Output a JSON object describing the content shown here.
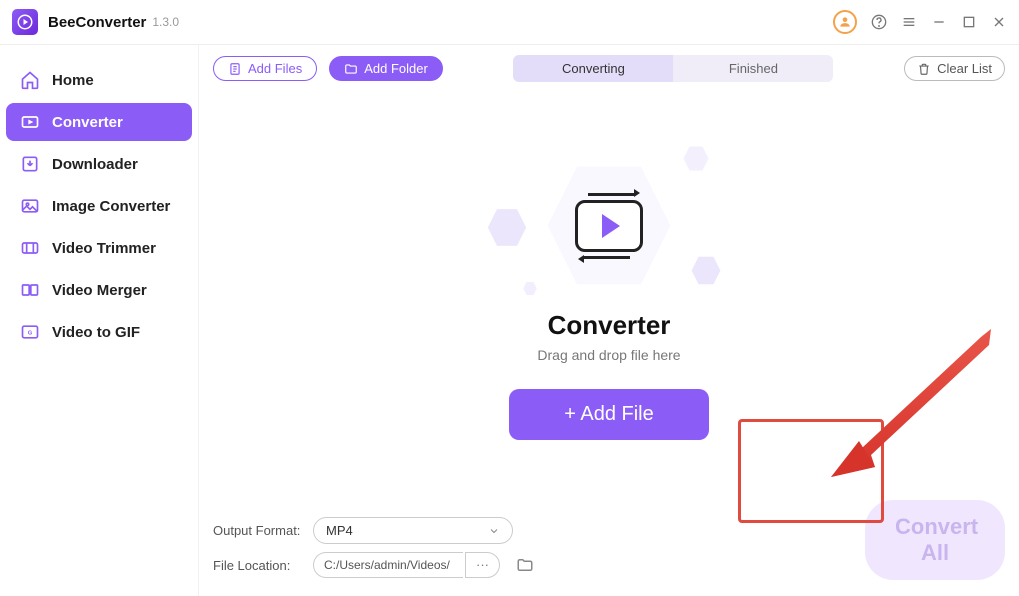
{
  "app": {
    "name": "BeeConverter",
    "version": "1.3.0"
  },
  "sidebar": {
    "items": [
      {
        "label": "Home"
      },
      {
        "label": "Converter"
      },
      {
        "label": "Downloader"
      },
      {
        "label": "Image Converter"
      },
      {
        "label": "Video Trimmer"
      },
      {
        "label": "Video Merger"
      },
      {
        "label": "Video to GIF"
      }
    ]
  },
  "toolbar": {
    "add_files": "Add Files",
    "add_folder": "Add Folder",
    "tab_converting": "Converting",
    "tab_finished": "Finished",
    "clear_list": "Clear List"
  },
  "center": {
    "title": "Converter",
    "subtitle": "Drag and drop file here",
    "add_file": "+ Add File"
  },
  "bottom": {
    "output_format_label": "Output Format:",
    "output_format_value": "MP4",
    "file_location_label": "File Location:",
    "file_location_value": "C:/Users/admin/Videos/",
    "more": "···",
    "convert_all": "Convert All"
  }
}
